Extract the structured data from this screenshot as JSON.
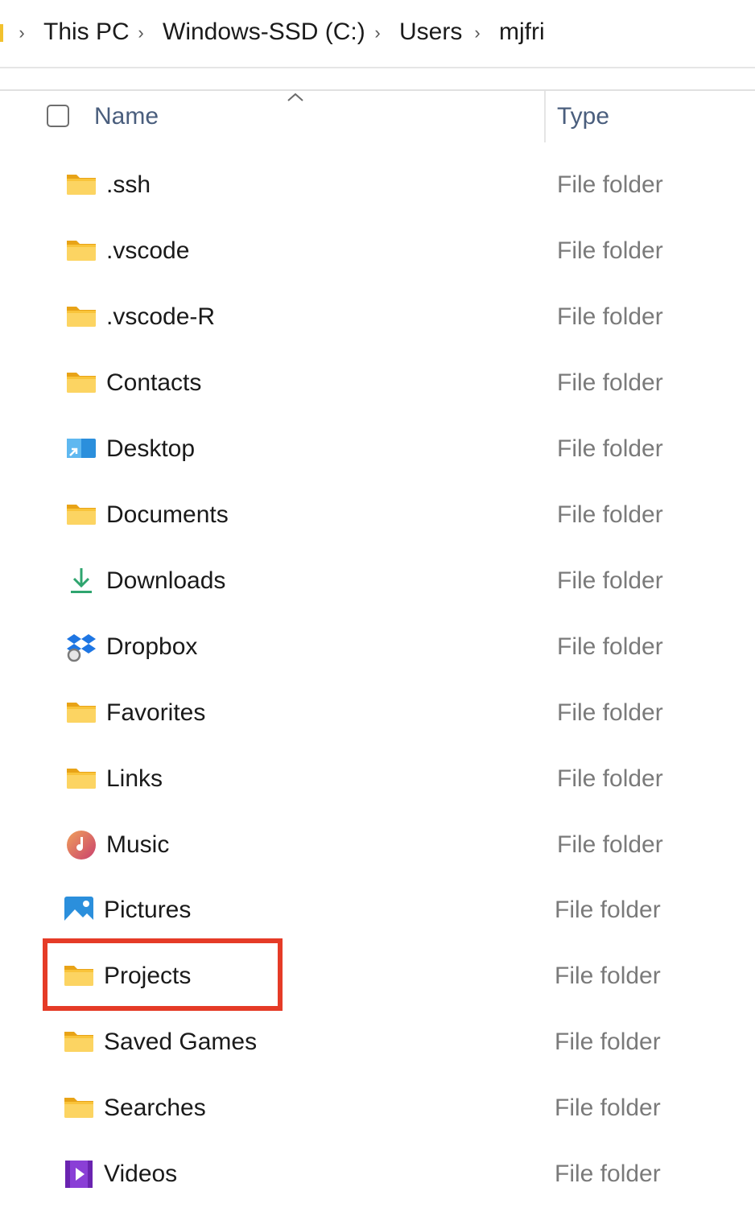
{
  "breadcrumb": {
    "items": [
      "This PC",
      "Windows-SSD (C:)",
      "Users",
      "mjfri"
    ],
    "separator": "›"
  },
  "columns": {
    "name": "Name",
    "type": "Type",
    "sort_direction": "ascending"
  },
  "highlight_color": "#e53b27",
  "files": [
    {
      "name": ".ssh",
      "type": "File folder",
      "icon": "folder-icon"
    },
    {
      "name": ".vscode",
      "type": "File folder",
      "icon": "folder-icon"
    },
    {
      "name": ".vscode-R",
      "type": "File folder",
      "icon": "folder-icon"
    },
    {
      "name": "Contacts",
      "type": "File folder",
      "icon": "folder-icon"
    },
    {
      "name": "Desktop",
      "type": "File folder",
      "icon": "desktop-icon"
    },
    {
      "name": "Documents",
      "type": "File folder",
      "icon": "folder-icon"
    },
    {
      "name": "Downloads",
      "type": "File folder",
      "icon": "downloads-icon"
    },
    {
      "name": "Dropbox",
      "type": "File folder",
      "icon": "dropbox-icon"
    },
    {
      "name": "Favorites",
      "type": "File folder",
      "icon": "folder-icon"
    },
    {
      "name": "Links",
      "type": "File folder",
      "icon": "folder-icon"
    },
    {
      "name": "Music",
      "type": "File folder",
      "icon": "music-icon"
    },
    {
      "name": "Pictures",
      "type": "File folder",
      "icon": "pictures-icon"
    },
    {
      "name": "Projects",
      "type": "File folder",
      "icon": "folder-icon",
      "highlighted": true
    },
    {
      "name": "Saved Games",
      "type": "File folder",
      "icon": "folder-icon"
    },
    {
      "name": "Searches",
      "type": "File folder",
      "icon": "folder-icon"
    },
    {
      "name": "Videos",
      "type": "File folder",
      "icon": "videos-icon"
    }
  ]
}
